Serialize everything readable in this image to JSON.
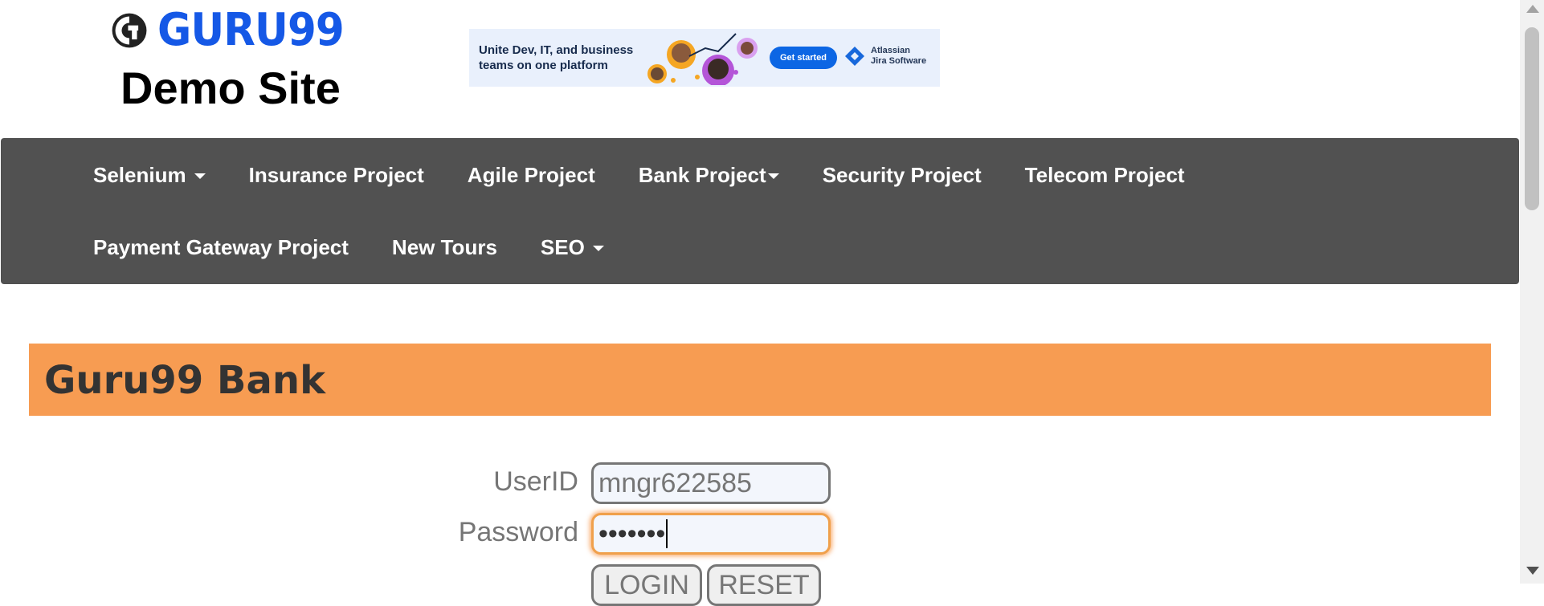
{
  "header": {
    "logo_text": "GURU99",
    "site_title": "Demo Site"
  },
  "ad": {
    "headline": "Unite Dev, IT, and business teams on one platform",
    "cta": "Get started",
    "brand_line1": "Atlassian",
    "brand_line2": "Jira Software"
  },
  "nav": {
    "row1": [
      {
        "label": "Selenium",
        "dropdown": true
      },
      {
        "label": "Insurance Project",
        "dropdown": false
      },
      {
        "label": "Agile Project",
        "dropdown": false
      },
      {
        "label": "Bank Project",
        "dropdown": true
      },
      {
        "label": "Security Project",
        "dropdown": false
      },
      {
        "label": "Telecom Project",
        "dropdown": false
      }
    ],
    "row2": [
      {
        "label": "Payment Gateway Project",
        "dropdown": false
      },
      {
        "label": "New Tours",
        "dropdown": false
      },
      {
        "label": "SEO",
        "dropdown": true
      }
    ]
  },
  "bank": {
    "title": "Guru99 Bank"
  },
  "form": {
    "userid_label": "UserID",
    "userid_value": "mngr622585",
    "password_label": "Password",
    "password_masked": "•••••••",
    "login_label": "LOGIN",
    "reset_label": "RESET"
  },
  "colors": {
    "nav_bg": "#515151",
    "bank_banner": "#f79c52",
    "logo_blue": "#1558e6",
    "focus_ring": "#f0a04b"
  }
}
